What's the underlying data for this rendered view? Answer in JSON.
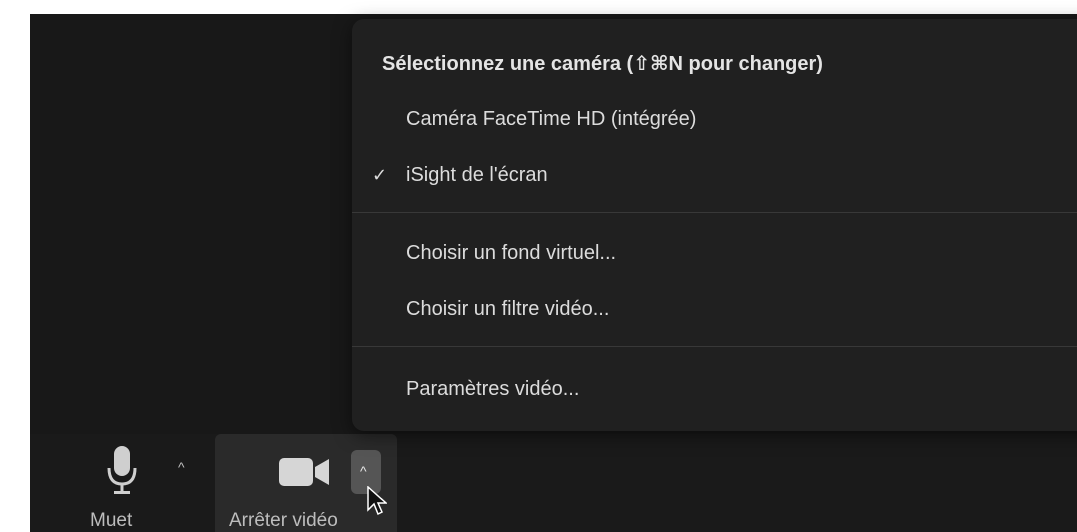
{
  "camera_menu": {
    "header": "Sélectionnez une caméra (⇧⌘N pour changer)",
    "cameras": [
      {
        "label": "Caméra FaceTime HD (intégrée)",
        "checked": false
      },
      {
        "label": "iSight de l'écran",
        "checked": true
      }
    ],
    "check_mark": "✓",
    "actions": [
      {
        "label": "Choisir un fond virtuel..."
      },
      {
        "label": "Choisir un filtre vidéo..."
      }
    ],
    "settings_label": "Paramètres vidéo..."
  },
  "toolbar": {
    "mute": {
      "label": "Muet",
      "icon": "microphone-icon",
      "caret": "^"
    },
    "video": {
      "label": "Arrêter vidéo",
      "icon": "video-camera-icon",
      "caret": "^"
    }
  },
  "colors": {
    "background": "#161616",
    "menu": "#202020",
    "text": "#dcdcdc"
  }
}
